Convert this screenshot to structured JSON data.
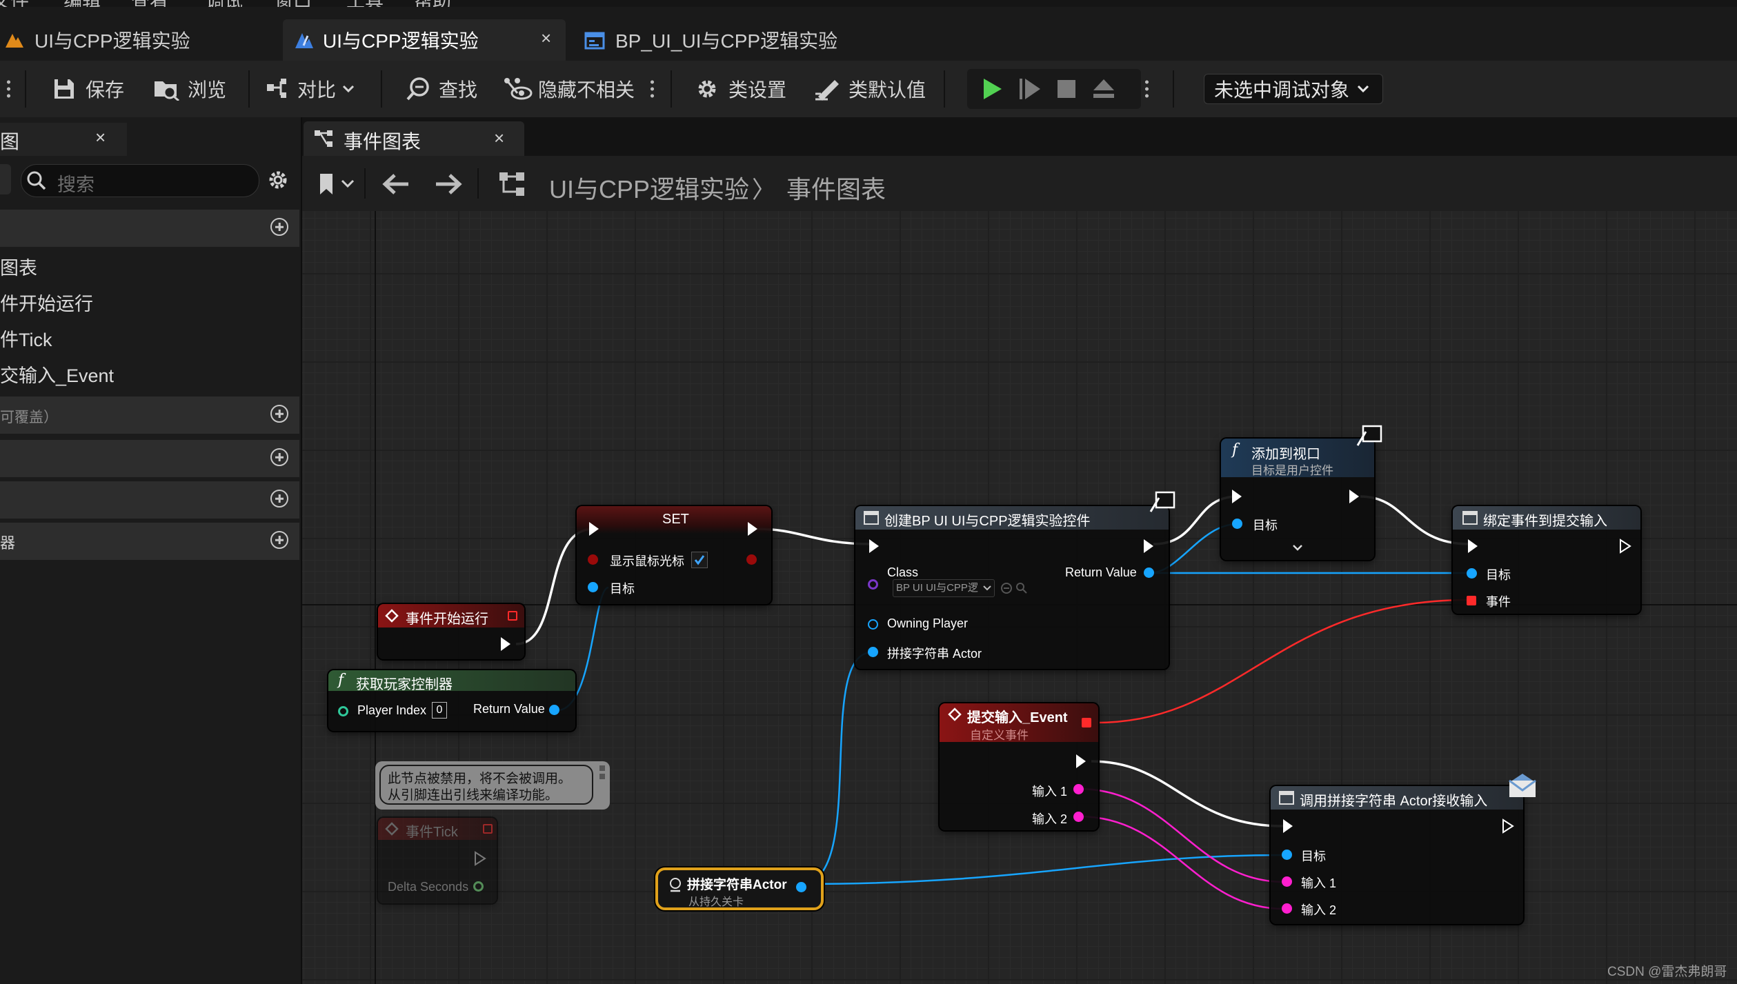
{
  "menu": {
    "items": [
      "文件",
      "编辑",
      "查看",
      "调试",
      "窗口",
      "工具",
      "帮助"
    ]
  },
  "doc_tabs": [
    {
      "label": "UI与CPP逻辑实验",
      "icon": "level-icon"
    },
    {
      "label": "UI与CPP逻辑实验",
      "icon": "blueprint-icon",
      "active": true,
      "close": "×"
    },
    {
      "label": "BP_UI_UI与CPP逻辑实验",
      "icon": "widget-blueprint-icon"
    }
  ],
  "toolbar": {
    "save": "保存",
    "browse": "浏览",
    "diff": "对比",
    "find": "查找",
    "hide_unrelated": "隐藏不相关",
    "class_settings": "类设置",
    "class_defaults": "类默认值",
    "debug_target": "未选中调试对象"
  },
  "left_panel": {
    "tab": "图",
    "tab_close": "×",
    "search_placeholder": "搜索",
    "graph_items": [
      "图表",
      "件开始运行",
      "件Tick",
      "交输入_Event"
    ],
    "overridable_label": "可覆盖）",
    "last_section_label": "器"
  },
  "graph": {
    "tab_label": "事件图表",
    "tab_close": "×",
    "breadcrumb_root": "UI与CPP逻辑实验",
    "breadcrumb_sep": "〉",
    "breadcrumb_leaf": "事件图表"
  },
  "nodes": {
    "event_begin": {
      "title": "事件开始运行"
    },
    "get_controller": {
      "title": "获取玩家控制器",
      "player_index_label": "Player Index",
      "player_index_value": "0",
      "return_label": "Return Value"
    },
    "set_node": {
      "title": "SET",
      "show_cursor_label": "显示鼠标光标",
      "target_label": "目标"
    },
    "create_widget": {
      "title": "创建BP UI UI与CPP逻辑实验控件",
      "class_label": "Class",
      "class_value": "BP UI UI与CPP逻",
      "return_label": "Return Value",
      "owning_player_label": "Owning Player",
      "actor_label": "拼接字符串 Actor"
    },
    "add_viewport": {
      "title": "添加到视口",
      "subtitle": "目标是用户控件",
      "target_label": "目标"
    },
    "bind_event": {
      "title": "绑定事件到提交输入",
      "target_label": "目标",
      "event_label": "事件"
    },
    "submit_event": {
      "title": "提交输入_Event",
      "subtitle": "自定义事件",
      "input1_label": "输入 1",
      "input2_label": "输入 2"
    },
    "call_actor": {
      "title": "调用拼接字符串 Actor接收输入",
      "target_label": "目标",
      "input1_label": "输入 1",
      "input2_label": "输入 2"
    },
    "disabled_comment": {
      "line1": "此节点被禁用，将不会被调用。",
      "line2": "从引脚连出引线来编译功能。"
    },
    "event_tick": {
      "title": "事件Tick",
      "delta_label": "Delta Seconds"
    },
    "actor_ref": {
      "title": "拼接字符串Actor",
      "subtitle": "从持久关卡"
    }
  },
  "watermark": "CSDN @雷杰弗朗哥",
  "colors": {
    "exec_wire": "#ffffff",
    "object_wire": "#17a5ff",
    "string_wire": "#ff1fcf",
    "delegate_wire": "#ff2a2a",
    "play_green": "#52d152",
    "event_header": "#8a1414",
    "function_header": "#1f3a56",
    "pure_function_header": "#2f5a34",
    "widget_header": "#3d4650",
    "actor_ref_border": "#e0a11b"
  }
}
